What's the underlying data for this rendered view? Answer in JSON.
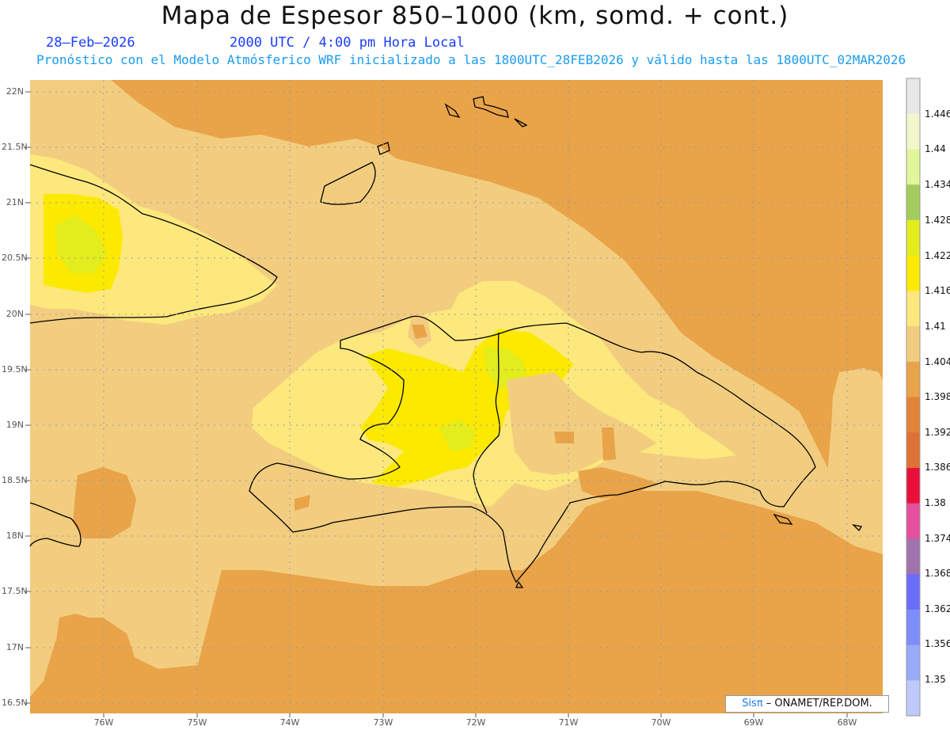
{
  "title": "Mapa de Espesor 850–1000 (km, somd. + cont.)",
  "date": "28–Feb–2026",
  "time": "2000 UTC / 4:00 pm Hora Local",
  "subtitle": "Pronóstico con el Modelo Atmósferico WRF inicializado a las 1800UTC_28FEB2026 y válido hasta las  1800UTC_02MAR2026",
  "lat_labels": [
    "22N",
    "21.5N",
    "21N",
    "20.5N",
    "20N",
    "19.5N",
    "19N",
    "18.5N",
    "18N",
    "17.5N",
    "17N",
    "16.5N"
  ],
  "lon_labels": [
    "76W",
    "75W",
    "74W",
    "73W",
    "72W",
    "71W",
    "70W",
    "69W",
    "68W"
  ],
  "colorbar": {
    "labels": [
      "1.446",
      "1.44",
      "1.434",
      "1.428",
      "1.422",
      "1.416",
      "1.41",
      "1.404",
      "1.398",
      "1.392",
      "1.386",
      "1.38",
      "1.374",
      "1.368",
      "1.362",
      "1.356",
      "1.35"
    ],
    "colors": [
      "#e8e8e8",
      "#f2f7cc",
      "#e1f59c",
      "#a3cc5e",
      "#e3ec1c",
      "#fbe900",
      "#fde87e",
      "#f2cd7f",
      "#e9a348",
      "#e08438",
      "#de7236",
      "#e8103a",
      "#e54f9e",
      "#a073ae",
      "#6c6cfb",
      "#7d8dfb",
      "#98acfb",
      "#bfc9fb"
    ]
  },
  "credit": {
    "brand": "Sisπ",
    "org": " – ONAMET/REP.DOM."
  }
}
